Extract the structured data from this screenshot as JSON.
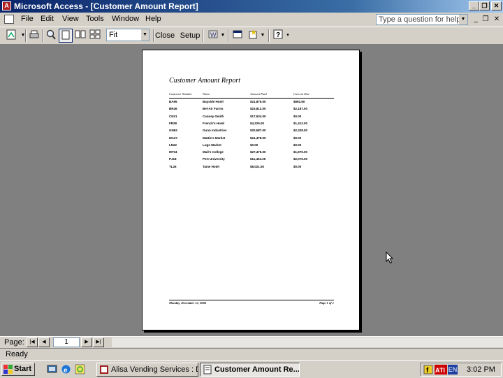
{
  "window": {
    "title": "Microsoft Access - [Customer Amount Report]"
  },
  "menu": {
    "items": [
      "File",
      "Edit",
      "View",
      "Tools",
      "Window",
      "Help"
    ],
    "help_placeholder": "Type a question for help"
  },
  "toolbar": {
    "zoom": "Fit",
    "close_label": "Close",
    "setup_label": "Setup"
  },
  "report": {
    "title": "Customer Amount Report",
    "headers": [
      "Customer Number",
      "Name",
      "Amount Paid",
      "Current Due"
    ],
    "rows": [
      [
        "BA95",
        "Bayside Hotel",
        "$21,876.00",
        "$892.50"
      ],
      [
        "BR46",
        "Bel-Air Farms",
        "$23,812.00",
        "$2,187.00"
      ],
      [
        "CN21",
        "Canney-Smith",
        "$17,534.00",
        "$0.00"
      ],
      [
        "FR28",
        "French's Hotel",
        "$4,225.00",
        "$1,412.00"
      ],
      [
        "GN62",
        "Gunn Industries",
        "$20,587.00",
        "$2,328.00"
      ],
      [
        "MA27",
        "Mattie's Market",
        "$21,478.00",
        "$0.00"
      ],
      [
        "LN22",
        "Lugo Market",
        "$0.00",
        "$0.00"
      ],
      [
        "MT04",
        "Mail's College",
        "$27,476.00",
        "$1,970.00"
      ],
      [
        "PJ18",
        "Pert University",
        "$11,404.25",
        "$2,075.00"
      ],
      [
        "TL26",
        "Tame Hotel",
        "$8,021.50",
        "$0.00"
      ]
    ],
    "footer_date": "Monday, December 13, 2004",
    "footer_page": "Page 1 of 1"
  },
  "nav": {
    "label": "Page:",
    "page": "1"
  },
  "status": {
    "text": "Ready"
  },
  "taskbar": {
    "start": "Start",
    "tasks": [
      "Alisa Vending Services : D...",
      "Customer Amount Re..."
    ],
    "clock": "3:02 PM",
    "lang": "EN"
  }
}
